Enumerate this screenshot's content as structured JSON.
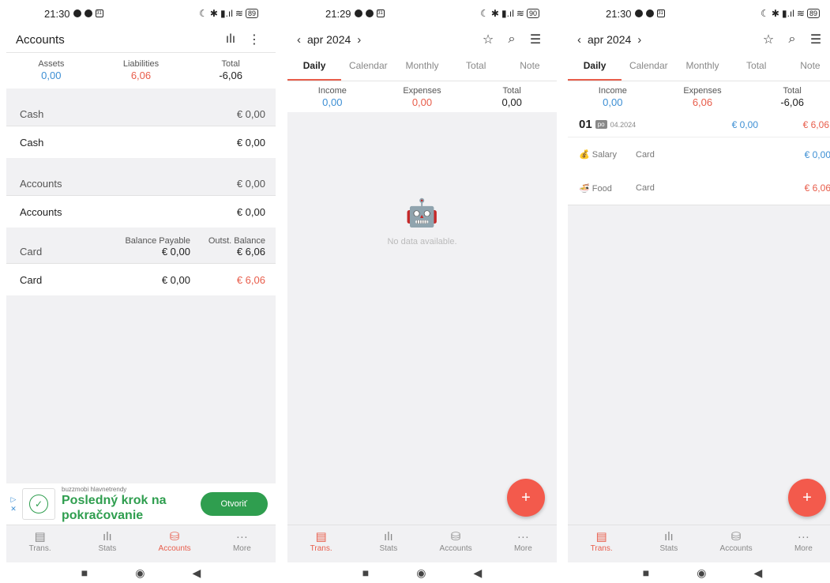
{
  "screens": [
    {
      "status": {
        "time": "21:30",
        "battery": "89"
      },
      "appbar": {
        "title": "Accounts",
        "stats_icon": "bar-chart-icon",
        "menu_icon": "more-vert-icon"
      },
      "summary": {
        "assets_label": "Assets",
        "assets_value": "0,00",
        "liabilities_label": "Liabilities",
        "liabilities_value": "6,06",
        "total_label": "Total",
        "total_value": "-6,06"
      },
      "groups": [
        {
          "name": "Cash",
          "amount": "€ 0,00",
          "items": [
            {
              "name": "Cash",
              "amount": "€ 0,00"
            }
          ]
        },
        {
          "name": "Accounts",
          "amount": "€ 0,00",
          "items": [
            {
              "name": "Accounts",
              "amount": "€ 0,00"
            }
          ]
        }
      ],
      "card_group": {
        "name": "Card",
        "balance_payable_label": "Balance Payable",
        "balance_payable_value": "€ 0,00",
        "outst_balance_label": "Outst. Balance",
        "outst_balance_value": "€ 6,06",
        "item": {
          "name": "Card",
          "balance_payable": "€ 0,00",
          "outst_balance": "€ 6,06"
        }
      },
      "ad": {
        "advertiser": "buzzmobi hlavnetrendy",
        "headline": "Posledný krok na pokračovanie",
        "button": "Otvoriť"
      },
      "bottomnav": [
        "Trans.",
        "Stats",
        "Accounts",
        "More"
      ]
    },
    {
      "status": {
        "time": "21:29",
        "battery": "90"
      },
      "appbar": {
        "period": "apr 2024"
      },
      "tabs": [
        "Daily",
        "Calendar",
        "Monthly",
        "Total",
        "Note"
      ],
      "summary": {
        "income_label": "Income",
        "income_value": "0,00",
        "expenses_label": "Expenses",
        "expenses_value": "0,00",
        "total_label": "Total",
        "total_value": "0,00"
      },
      "empty_text": "No data available.",
      "fab": "+",
      "bottomnav": [
        "Trans.",
        "Stats",
        "Accounts",
        "More"
      ]
    },
    {
      "status": {
        "time": "21:30",
        "battery": "89"
      },
      "appbar": {
        "period": "apr 2024"
      },
      "tabs": [
        "Daily",
        "Calendar",
        "Monthly",
        "Total",
        "Note"
      ],
      "summary": {
        "income_label": "Income",
        "income_value": "0,00",
        "expenses_label": "Expenses",
        "expenses_value": "6,06",
        "total_label": "Total",
        "total_value": "-6,06"
      },
      "day": {
        "number": "01",
        "weekday": "po",
        "date": "04.2024",
        "income": "€ 0,00",
        "expense": "€ 6,06"
      },
      "transactions": [
        {
          "icon": "💰",
          "category": "Salary",
          "account": "Card",
          "amount": "€ 0,00",
          "type": "income"
        },
        {
          "icon": "🍜",
          "category": "Food",
          "account": "Card",
          "amount": "€ 6,06",
          "type": "expense"
        }
      ],
      "fab": "+",
      "bottomnav": [
        "Trans.",
        "Stats",
        "Accounts",
        "More"
      ]
    }
  ],
  "colors": {
    "accent": "#e85d4b",
    "income": "#3d8fd4",
    "ad_green": "#2f9e4f",
    "fab": "#f35a4c"
  }
}
